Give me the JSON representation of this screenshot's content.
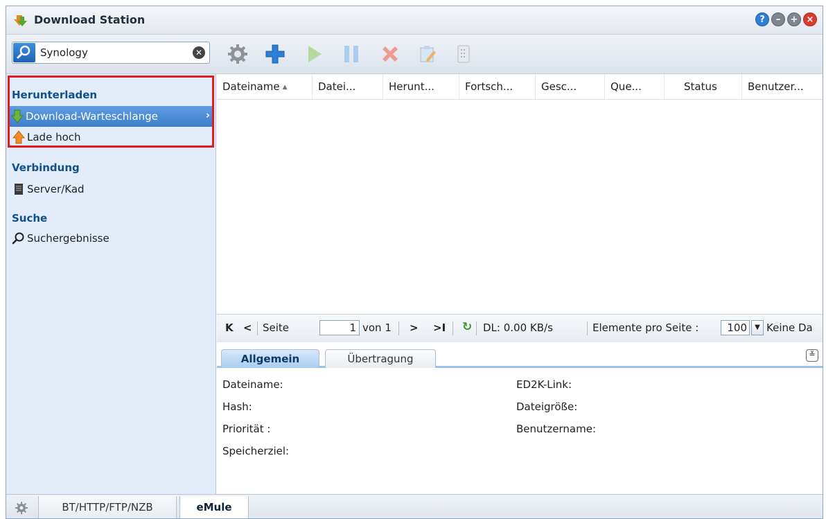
{
  "window": {
    "title": "Download Station",
    "controls": [
      "help-icon",
      "minimize-icon",
      "maximize-icon",
      "close-icon"
    ]
  },
  "search": {
    "value": "Synology",
    "placeholder": ""
  },
  "toolbar": {
    "buttons": [
      "settings",
      "add",
      "resume",
      "pause",
      "delete",
      "edit",
      "clear-completed"
    ]
  },
  "sidebar": {
    "sections": [
      {
        "heading": "Herunterladen",
        "items": [
          {
            "label": "Download-Warteschlange",
            "icon": "download-arrow-icon",
            "selected": true
          },
          {
            "label": "Lade hoch",
            "icon": "upload-arrow-icon",
            "selected": false
          }
        ]
      },
      {
        "heading": "Verbindung",
        "items": [
          {
            "label": "Server/Kad",
            "icon": "server-icon",
            "selected": false
          }
        ]
      },
      {
        "heading": "Suche",
        "items": [
          {
            "label": "Suchergebnisse",
            "icon": "search-icon",
            "selected": false
          }
        ]
      }
    ]
  },
  "grid": {
    "columns": [
      "Dateiname",
      "Datei...",
      "Herunt...",
      "Fortsch...",
      "Gesc...",
      "Que...",
      "Status",
      "Benutzer..."
    ],
    "rows": []
  },
  "pager": {
    "page_label": "Seite",
    "page_value": "1",
    "of_label": "von 1",
    "speed": "DL: 0.00 KB/s",
    "per_page_label": "Elemente pro Seite :",
    "per_page_value": "100",
    "empty_text": "Keine Da"
  },
  "details": {
    "tabs": [
      "Allgemein",
      "Übertragung"
    ],
    "fields_left": [
      "Dateiname:",
      "Hash:",
      "Priorität :",
      "Speicherziel:"
    ],
    "fields_right": [
      "ED2K-Link:",
      "Dateigröße:",
      "Benutzername:"
    ]
  },
  "bottom_tabs": [
    "BT/HTTP/FTP/NZB",
    "eMule"
  ],
  "colors": {
    "accent": "#3d7fcc",
    "sidebar_bg": "#e2edf9",
    "highlight_box": "#e01b24"
  }
}
